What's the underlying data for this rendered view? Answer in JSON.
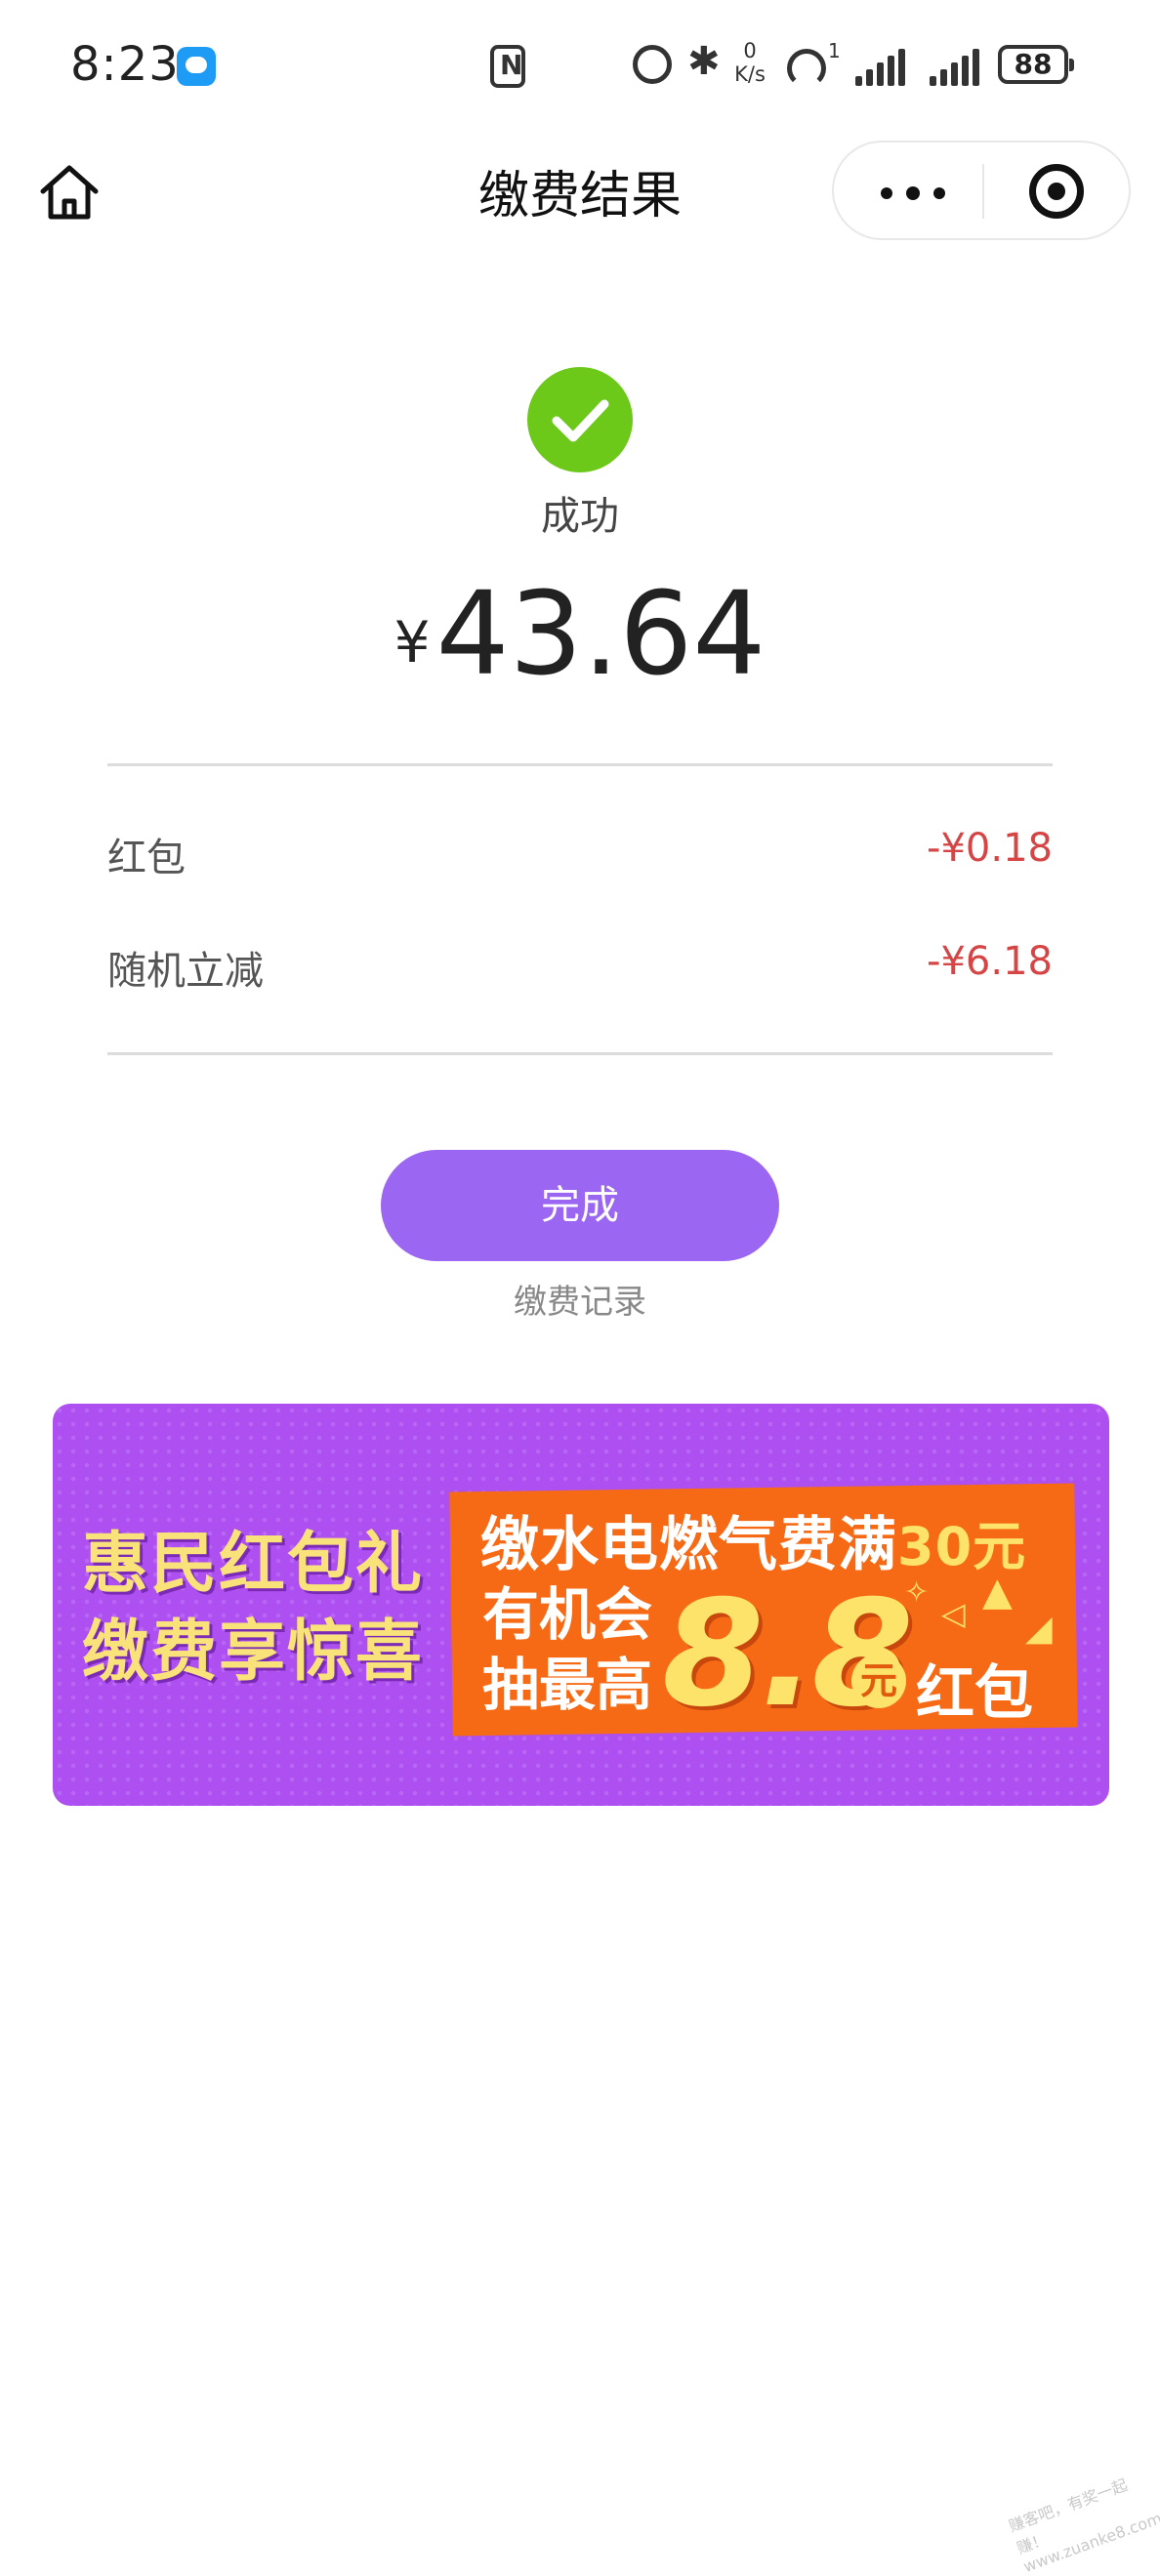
{
  "status_bar": {
    "time": "8:23",
    "speed_value": "0",
    "speed_unit": "K/s",
    "hotspot_count": "1",
    "battery": "88"
  },
  "nav": {
    "title": "缴费结果"
  },
  "result": {
    "status": "成功",
    "currency": "¥",
    "amount": "43.64",
    "status_color": "#6cc91a"
  },
  "discounts": [
    {
      "label": "红包",
      "value": "-¥0.18"
    },
    {
      "label": "随机立减",
      "value": "-¥6.18"
    }
  ],
  "actions": {
    "done_label": "完成",
    "records_label": "缴费记录",
    "accent_color": "#9b66f2"
  },
  "banner": {
    "left_line1": "惠民红包礼",
    "left_line2": "缴费享惊喜",
    "line1_prefix": "缴水电燃气费满",
    "line1_highlight": "30元",
    "line2": "有机会",
    "line3": "抽最高",
    "big_amount": "8.8",
    "big_unit": "元",
    "tail": "红包"
  },
  "watermark": "赚客吧，有奖一起赚！ www.zuanke8.com"
}
